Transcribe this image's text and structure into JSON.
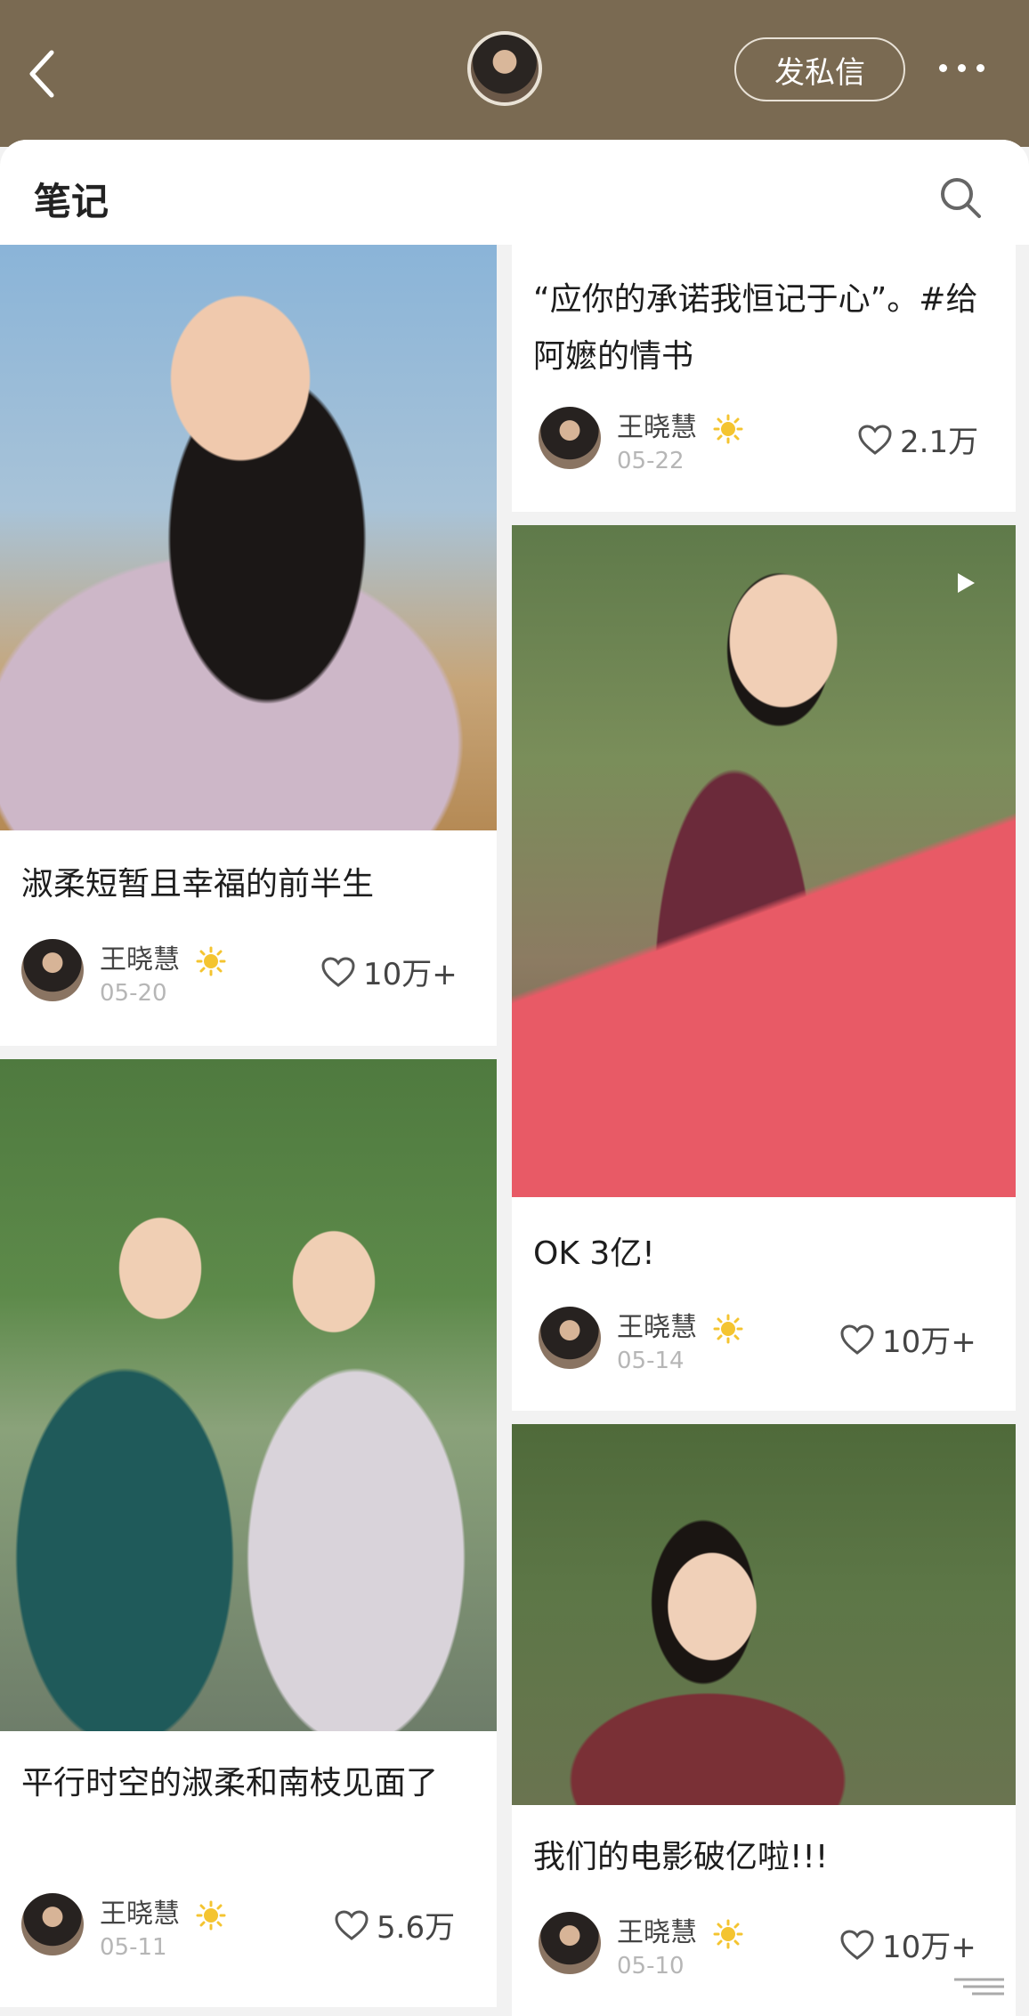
{
  "header": {
    "dm_label": "发私信",
    "section_title": "笔记"
  },
  "author_name": "王晓慧",
  "notes": [
    {
      "title": "淑柔短暂且幸福的前半生",
      "date": "05-20",
      "likes": "10万+"
    },
    {
      "title": "“应你的承诺我恒记于心”。#给阿嬷的情书",
      "date": "05-22",
      "likes": "2.1万"
    },
    {
      "title": "OK 3亿!",
      "date": "05-14",
      "likes": "10万+",
      "is_video": true
    },
    {
      "title": "平行时空的淑柔和南枝见面了",
      "date": "05-11",
      "likes": "5.6万"
    },
    {
      "title": "我们的电影破亿啦!!!",
      "date": "05-10",
      "likes": "10万+"
    }
  ],
  "colors": {
    "topbar": "#7a6a52",
    "card_bg": "#ffffff",
    "page_bg": "#f2f2f2",
    "date": "#b6b6b6"
  },
  "icons": {
    "back": "chevron-left-icon",
    "more": "more-dots-icon",
    "search": "search-icon",
    "like": "heart-outline-icon",
    "verified": "sun-badge-icon",
    "video": "play-icon"
  }
}
